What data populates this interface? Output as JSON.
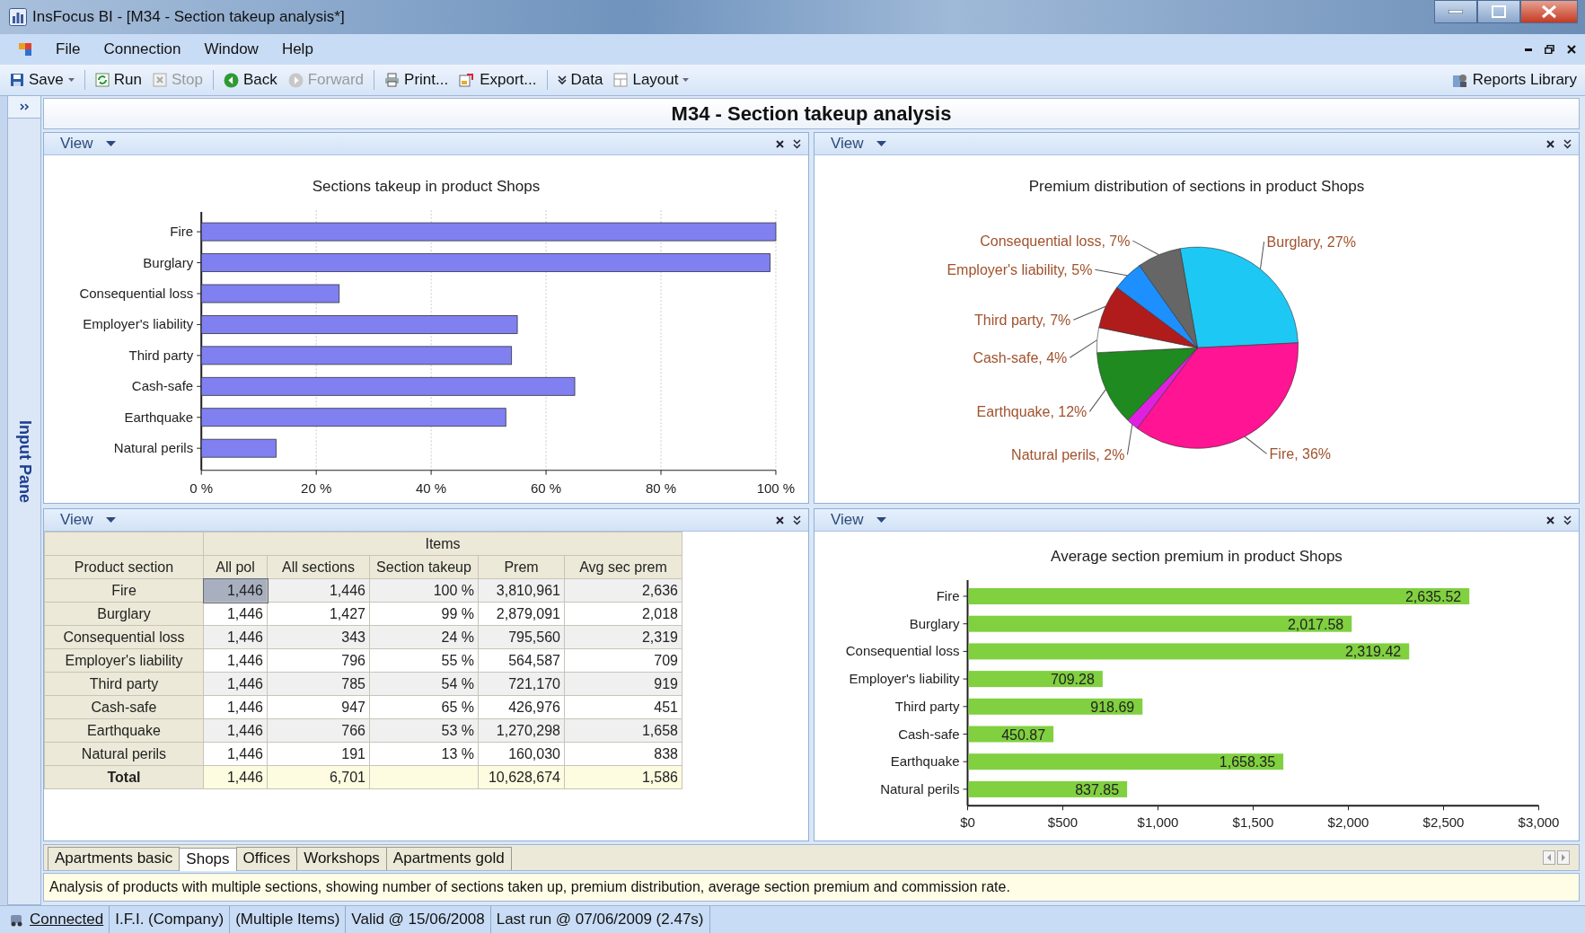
{
  "window": {
    "title": "InsFocus BI - [M34 - Section takeup analysis*]"
  },
  "menu": [
    "File",
    "Connection",
    "Window",
    "Help"
  ],
  "toolbar": [
    [
      {
        "label": "Save",
        "dropdown": true,
        "disabled": false
      }
    ],
    [
      {
        "label": "Run",
        "dropdown": false,
        "disabled": false
      },
      {
        "label": "Stop",
        "dropdown": false,
        "disabled": true
      }
    ],
    [
      {
        "label": "Back",
        "dropdown": false,
        "disabled": false
      },
      {
        "label": "Forward",
        "dropdown": false,
        "disabled": true
      }
    ],
    [
      {
        "label": "Print...",
        "dropdown": false,
        "disabled": false
      },
      {
        "label": "Export...",
        "dropdown": false,
        "disabled": false
      }
    ],
    [
      {
        "label": "Data",
        "dropdown": false,
        "disabled": false
      },
      {
        "label": "Layout",
        "dropdown": true,
        "disabled": false
      }
    ]
  ],
  "reports_library": "Reports Library",
  "side_pane": {
    "label": "Input Pane",
    "expanded": false
  },
  "report_title": "M34 - Section takeup analysis",
  "panels": [
    {
      "view_label": "View",
      "kind": "chart",
      "chart_data": {
        "type": "bar",
        "orientation": "horizontal",
        "grid": true,
        "title": "Sections takeup in product  Shops",
        "categories": [
          "Fire",
          "Burglary",
          "Consequential loss",
          "Employer's liability",
          "Third party",
          "Cash-safe",
          "Earthquake",
          "Natural perils"
        ],
        "series": [
          {
            "color": "#8080f0",
            "values": [
              100,
              99,
              24,
              55,
              54,
              65,
              53,
              13
            ]
          }
        ],
        "xlim": [
          0,
          100
        ],
        "xticks": [
          {
            "value": 0,
            "label": "0 %"
          },
          {
            "value": 20,
            "label": "20 %"
          },
          {
            "value": 40,
            "label": "40 %"
          },
          {
            "value": 60,
            "label": "60 %"
          },
          {
            "value": 80,
            "label": "80 %"
          },
          {
            "value": 100,
            "label": "100 %"
          }
        ]
      }
    },
    {
      "view_label": "View",
      "kind": "chart",
      "chart_data": {
        "type": "pie",
        "title": "Premium distribution of sections in product Shops",
        "values": [
          27,
          36,
          2,
          12,
          4,
          7,
          5,
          7
        ],
        "colors": [
          "#1ec8f5",
          "#ff1493",
          "#e020e0",
          "#1f8a1f",
          "#ffffff",
          "#b01c1c",
          "#1e8fff",
          "#666666"
        ],
        "value_labels": [
          "Burglary, 27%",
          "Fire, 36%",
          "Natural perils, 2%",
          "Earthquake, 12%",
          "Cash-safe, 4%",
          "Third party, 7%",
          "Employer's liability, 5%",
          "Consequential loss, 7%"
        ]
      }
    },
    {
      "view_label": "View",
      "kind": "table",
      "table": {
        "group_header": "Items",
        "columns": [
          "Product section",
          "All pol",
          "All sections",
          "Section takeup",
          "Prem",
          "Avg sec prem"
        ],
        "rows": [
          {
            "kind": "data",
            "cells": [
              {
                "text": "Fire",
                "selected": false
              },
              {
                "text": "1,446",
                "selected": true
              },
              {
                "text": "1,446",
                "selected": false
              },
              {
                "text": "100 %",
                "selected": false
              },
              {
                "text": "3,810,961",
                "selected": false
              },
              {
                "text": "2,636",
                "selected": false
              }
            ]
          },
          {
            "kind": "data",
            "cells": [
              {
                "text": "Burglary",
                "selected": false
              },
              {
                "text": "1,446",
                "selected": false
              },
              {
                "text": "1,427",
                "selected": false
              },
              {
                "text": "99 %",
                "selected": false
              },
              {
                "text": "2,879,091",
                "selected": false
              },
              {
                "text": "2,018",
                "selected": false
              }
            ]
          },
          {
            "kind": "data",
            "cells": [
              {
                "text": "Consequential loss",
                "selected": false
              },
              {
                "text": "1,446",
                "selected": false
              },
              {
                "text": "343",
                "selected": false
              },
              {
                "text": "24 %",
                "selected": false
              },
              {
                "text": "795,560",
                "selected": false
              },
              {
                "text": "2,319",
                "selected": false
              }
            ]
          },
          {
            "kind": "data",
            "cells": [
              {
                "text": "Employer's liability",
                "selected": false
              },
              {
                "text": "1,446",
                "selected": false
              },
              {
                "text": "796",
                "selected": false
              },
              {
                "text": "55 %",
                "selected": false
              },
              {
                "text": "564,587",
                "selected": false
              },
              {
                "text": "709",
                "selected": false
              }
            ]
          },
          {
            "kind": "data",
            "cells": [
              {
                "text": "Third party",
                "selected": false
              },
              {
                "text": "1,446",
                "selected": false
              },
              {
                "text": "785",
                "selected": false
              },
              {
                "text": "54 %",
                "selected": false
              },
              {
                "text": "721,170",
                "selected": false
              },
              {
                "text": "919",
                "selected": false
              }
            ]
          },
          {
            "kind": "data",
            "cells": [
              {
                "text": "Cash-safe",
                "selected": false
              },
              {
                "text": "1,446",
                "selected": false
              },
              {
                "text": "947",
                "selected": false
              },
              {
                "text": "65 %",
                "selected": false
              },
              {
                "text": "426,976",
                "selected": false
              },
              {
                "text": "451",
                "selected": false
              }
            ]
          },
          {
            "kind": "data",
            "cells": [
              {
                "text": "Earthquake",
                "selected": false
              },
              {
                "text": "1,446",
                "selected": false
              },
              {
                "text": "766",
                "selected": false
              },
              {
                "text": "53 %",
                "selected": false
              },
              {
                "text": "1,270,298",
                "selected": false
              },
              {
                "text": "1,658",
                "selected": false
              }
            ]
          },
          {
            "kind": "data",
            "cells": [
              {
                "text": "Natural perils",
                "selected": false
              },
              {
                "text": "1,446",
                "selected": false
              },
              {
                "text": "191",
                "selected": false
              },
              {
                "text": "13 %",
                "selected": false
              },
              {
                "text": "160,030",
                "selected": false
              },
              {
                "text": "838",
                "selected": false
              }
            ]
          },
          {
            "kind": "total",
            "cells": [
              {
                "text": "Total",
                "selected": false
              },
              {
                "text": "1,446",
                "selected": false
              },
              {
                "text": "6,701",
                "selected": false
              },
              {
                "text": "",
                "selected": false
              },
              {
                "text": "10,628,674",
                "selected": false
              },
              {
                "text": "1,586",
                "selected": false
              }
            ]
          }
        ]
      }
    },
    {
      "view_label": "View",
      "kind": "chart",
      "chart_data": {
        "type": "bar",
        "orientation": "horizontal",
        "title": "Average section premium in product Shops",
        "categories": [
          "Fire",
          "Burglary",
          "Consequential loss",
          "Employer's liability",
          "Third party",
          "Cash-safe",
          "Earthquake",
          "Natural perils"
        ],
        "series": [
          {
            "color": "#80d040",
            "values": [
              2635.52,
              2017.58,
              2319.42,
              709.28,
              918.69,
              450.87,
              1658.35,
              837.85
            ]
          }
        ],
        "value_labels": [
          "2,635.52",
          "2,017.58",
          "2,319.42",
          "709.28",
          "918.69",
          "450.87",
          "1,658.35",
          "837.85"
        ],
        "xlim": [
          0,
          3000
        ],
        "xticks": [
          {
            "value": 0,
            "label": "$0"
          },
          {
            "value": 500,
            "label": "$500"
          },
          {
            "value": 1000,
            "label": "$1,000"
          },
          {
            "value": 1500,
            "label": "$1,500"
          },
          {
            "value": 2000,
            "label": "$2,000"
          },
          {
            "value": 2500,
            "label": "$2,500"
          },
          {
            "value": 3000,
            "label": "$3,000"
          }
        ]
      }
    }
  ],
  "tabs": [
    {
      "label": "Apartments basic",
      "selected": false
    },
    {
      "label": "Shops",
      "selected": true
    },
    {
      "label": "Offices",
      "selected": false
    },
    {
      "label": "Workshops",
      "selected": false
    },
    {
      "label": "Apartments gold",
      "selected": false
    }
  ],
  "description": "Analysis of products with multiple sections, showing number of sections taken up, premium distribution, average section premium and commission rate.",
  "status_bar": [
    {
      "kind": "link",
      "text": "Connected"
    },
    {
      "kind": "text",
      "text": "I.F.I. (Company)"
    },
    {
      "kind": "text",
      "text": "(Multiple Items)"
    },
    {
      "kind": "text",
      "text": "Valid @ 15/06/2008"
    },
    {
      "kind": "text",
      "text": "Last run @ 07/06/2009 (2.47s)"
    }
  ]
}
